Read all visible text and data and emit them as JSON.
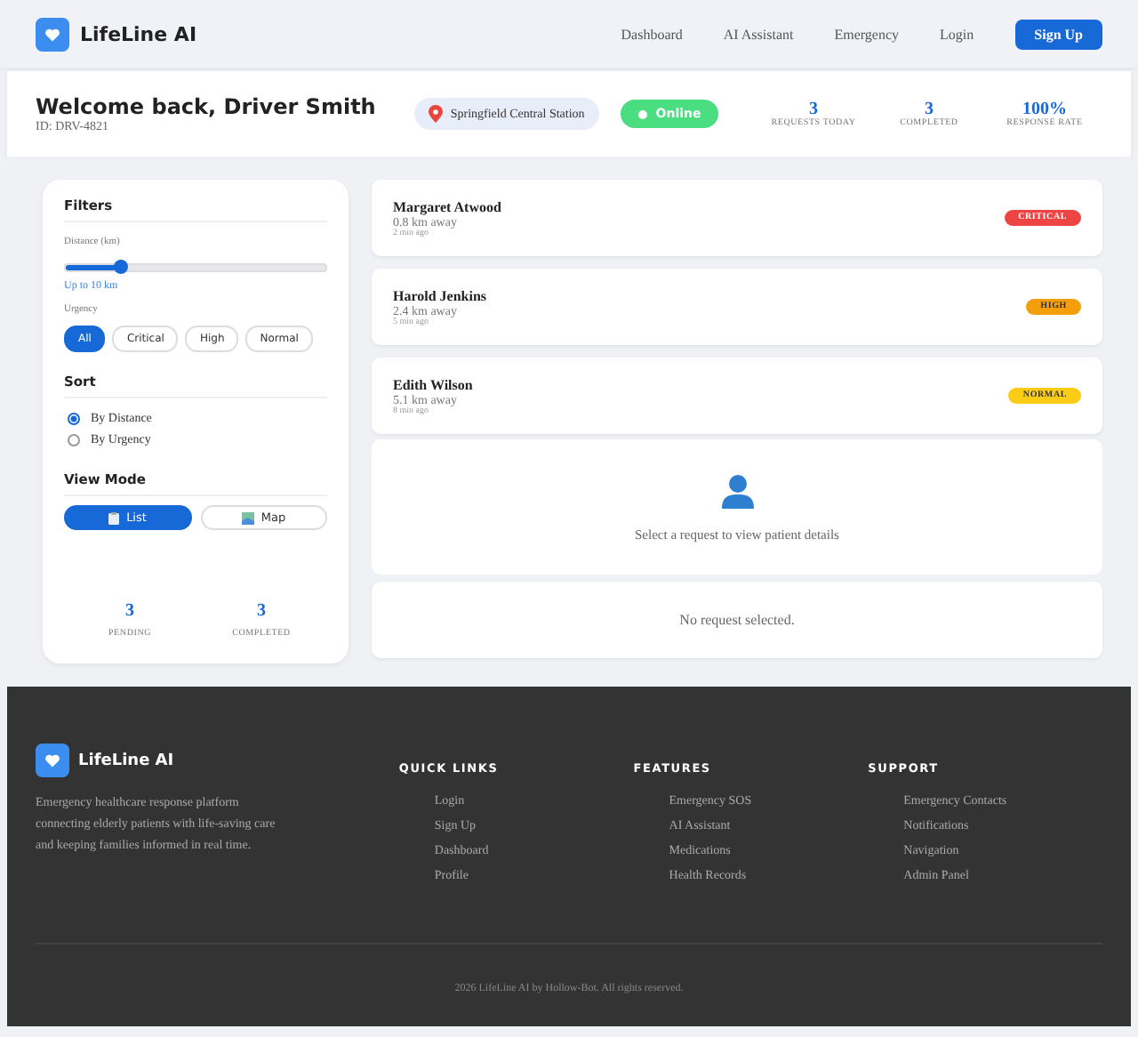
{
  "nav": {
    "brand": "LifeLine AI",
    "links": [
      {
        "label": "Dashboard"
      },
      {
        "label": "AI Assistant"
      },
      {
        "label": "Emergency"
      },
      {
        "label": "Login"
      }
    ],
    "cta": "Sign Up"
  },
  "header": {
    "title": "Welcome back, Driver Smith",
    "driver_id": "ID: DRV-4821",
    "location": "Springfield Central Station",
    "status": {
      "label": "Online",
      "on": true
    },
    "stats": [
      {
        "value": "3",
        "label": "REQUESTS TODAY"
      },
      {
        "value": "3",
        "label": "COMPLETED"
      },
      {
        "value": "100%",
        "label": "RESPONSE RATE"
      }
    ]
  },
  "filters": {
    "title": "Filters",
    "distance": {
      "label": "Distance (km)",
      "level": 0.21,
      "reading": "Up to 10 km"
    },
    "urgency": {
      "label": "Urgency",
      "options": [
        {
          "label": "All",
          "selected": true
        },
        {
          "label": "Critical",
          "selected": false
        },
        {
          "label": "High",
          "selected": false
        },
        {
          "label": "Normal",
          "selected": false
        }
      ]
    },
    "sort": {
      "title": "Sort",
      "options": [
        {
          "label": "By Distance",
          "selected": true
        },
        {
          "label": "By Urgency",
          "selected": false
        }
      ]
    },
    "view_mode": {
      "title": "View Mode",
      "options": [
        {
          "label": "List",
          "kind": "list",
          "selected": true
        },
        {
          "label": "Map",
          "kind": "map",
          "selected": false
        }
      ]
    },
    "stats": [
      {
        "value": "3",
        "label": "PENDING"
      },
      {
        "value": "3",
        "label": "COMPLETED"
      }
    ]
  },
  "requests": [
    {
      "name": "Margaret Atwood",
      "distance": "0.8 km away",
      "time": "2 min ago",
      "urgency": "CRITICAL",
      "color": "#ef4444"
    },
    {
      "name": "Harold Jenkins",
      "distance": "2.4 km away",
      "time": "5 min ago",
      "urgency": "HIGH",
      "color": "#f59e0b"
    },
    {
      "name": "Edith Wilson",
      "distance": "5.1 km away",
      "time": "8 min ago",
      "urgency": "NORMAL",
      "color": "#facc15"
    }
  ],
  "detail": {
    "prompt": "Select a request to view patient details"
  },
  "status_panel": {
    "text": "No request selected."
  },
  "footer": {
    "brand": "LifeLine AI",
    "description": "Emergency healthcare response platform connecting elderly patients with life-saving care and keeping families informed in real time.",
    "columns": [
      {
        "title": "QUICK LINKS",
        "links": [
          "Login",
          "Sign Up",
          "Dashboard",
          "Profile"
        ]
      },
      {
        "title": "FEATURES",
        "links": [
          "Emergency SOS",
          "AI Assistant",
          "Medications",
          "Health Records"
        ]
      },
      {
        "title": "SUPPORT",
        "links": [
          "Emergency Contacts",
          "Notifications",
          "Navigation",
          "Admin Panel"
        ]
      }
    ],
    "copyright": "2026 LifeLine AI by Hollow-Bot. All rights reserved."
  }
}
